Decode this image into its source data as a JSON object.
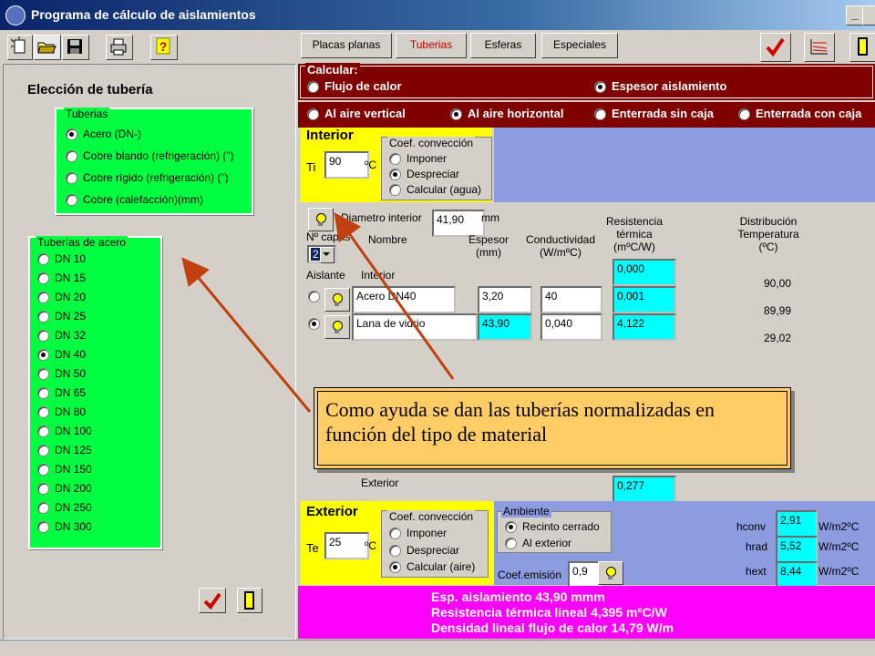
{
  "window": {
    "title": "Programa de cálculo de aislamientos",
    "minimize_label": "_"
  },
  "toolbar": {
    "tabs": [
      "Placas planas",
      "Tuberias",
      "Esferas",
      "Especiales"
    ]
  },
  "left_panel": {
    "title": "Elección de tubería",
    "tuberias": {
      "legend": "Tuberias",
      "options": [
        {
          "label": "Acero (DN-)",
          "selected": true
        },
        {
          "label": "Cobre blando (refrigeración) (\")",
          "selected": false
        },
        {
          "label": "Cobre rígido (refrigeración) (\")",
          "selected": false
        },
        {
          "label": "Cobre (calefacción)(mm)",
          "selected": false
        }
      ]
    },
    "acero": {
      "legend": "Tuberías de acero",
      "options": [
        {
          "label": "DN 10",
          "selected": false
        },
        {
          "label": "DN 15",
          "selected": false
        },
        {
          "label": "DN 20",
          "selected": false
        },
        {
          "label": "DN 25",
          "selected": false
        },
        {
          "label": "DN 32",
          "selected": false
        },
        {
          "label": "DN 40",
          "selected": true
        },
        {
          "label": "DN 50",
          "selected": false
        },
        {
          "label": "DN 65",
          "selected": false
        },
        {
          "label": "DN 80",
          "selected": false
        },
        {
          "label": "DN 100",
          "selected": false
        },
        {
          "label": "DN 125",
          "selected": false
        },
        {
          "label": "DN 150",
          "selected": false
        },
        {
          "label": "DN 200",
          "selected": false
        },
        {
          "label": "DN 250",
          "selected": false
        },
        {
          "label": "DN 300",
          "selected": false
        }
      ]
    }
  },
  "calcular": {
    "legend": "Calcular:",
    "flujo": "Flujo de calor",
    "espesor": "Espesor aislamiento",
    "al_aire_vertical": "Al aire vertical",
    "al_aire_horizontal": "Al aire horizontal",
    "enterrada_sin_caja": "Enterrada sin caja",
    "enterrada_con_caja": "Enterrada con caja"
  },
  "interior": {
    "title": "Interior",
    "ti_label": "Ti",
    "ti_value": "90",
    "ti_unit": "ºC",
    "coef_legend": "Coef. convección",
    "imponer": "Imponer",
    "despreciar": "Despreciar",
    "calcular_agua": "Calcular (agua)"
  },
  "table": {
    "diametro_label": "Diametro interior",
    "diametro_value": "41,90",
    "diametro_unit": "mm",
    "ncapas_label": "Nº capas",
    "ncapas_value": "2",
    "nombre_header": "Nombre",
    "espesor_header": "Espesor\n(mm)",
    "conductividad_header": "Conductividad\n(W/mºC)",
    "resistencia_header": "Resistencia\ntérmica\n(mºC/W)",
    "distribucion_header": "Distribución\nTemperatura\n(ºC)",
    "aislante_label": "Aislante",
    "interior_label": "Interior",
    "r_interior": "0,000",
    "t_interior": "90,00",
    "row1_name": "Acero DN40",
    "row1_espesor": "3,20",
    "row1_cond": "40",
    "row1_res": "0,001",
    "row1_temp": "89,99",
    "row2_name": "Lana de vidrio",
    "row2_espesor": "43,90",
    "row2_cond": "0,040",
    "row2_res": "4,122",
    "row2_temp": "29,02",
    "exterior_label": "Exterior",
    "r_exterior": "0,277"
  },
  "callout": {
    "text": "Como ayuda se dan las tuberías normalizadas en función del tipo de material"
  },
  "exterior": {
    "title": "Exterior",
    "te_label": "Te",
    "te_value": "25",
    "te_unit": "ºC",
    "coef_legend": "Coef. convección",
    "imponer": "Imponer",
    "despreciar": "Despreciar",
    "calcular_aire": "Calcular (aire)",
    "ambiente_legend": "Ambiente",
    "recinto": "Recinto cerrado",
    "al_exterior": "Al exterior",
    "coef_emision_label": "Coef.emisión",
    "coef_emision_value": "0,9",
    "hconv_label": "hconv",
    "hconv_value": "2,91",
    "hrad_label": "hrad",
    "hrad_value": "5,52",
    "hext_label": "hext",
    "hext_value": "8,44",
    "unit": "W/m2ºC"
  },
  "results": {
    "line1": "Esp. aislamiento 43,90 mmm",
    "line2": "Resistencia térmica lineal 4,395 mºC/W",
    "line3": "Densidad lineal flujo de calor 14,79 W/m"
  },
  "colors": {
    "red_band": "#800000",
    "yellow": "#ffff00",
    "blue_panel": "#8c9cde",
    "green": "#00ff40",
    "magenta": "#ff00ff",
    "callout": "#ffcc66",
    "arrow": "#c04010"
  }
}
